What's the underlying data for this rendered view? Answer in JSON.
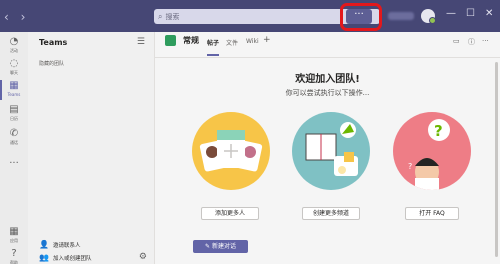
{
  "titlebar": {
    "nav_arrows": "‹ ›",
    "search_icon": "⌕",
    "search_placeholder": "搜索",
    "more_label": "···",
    "user_name": "",
    "window_controls": [
      "—",
      "☐",
      "✕"
    ]
  },
  "rail": {
    "items": [
      {
        "icon": "bell-icon",
        "glyph": "🔔",
        "label": "活动"
      },
      {
        "icon": "chat-icon",
        "glyph": "💬",
        "label": "聊天"
      },
      {
        "icon": "teams-icon",
        "glyph": "👥",
        "label": "Teams"
      },
      {
        "icon": "calendar-icon",
        "glyph": "📅",
        "label": "日历"
      },
      {
        "icon": "phone-icon",
        "glyph": "📞",
        "label": "通话"
      },
      {
        "icon": "more-icon",
        "glyph": "···",
        "label": ""
      }
    ],
    "bottom": [
      {
        "icon": "apps-icon",
        "glyph": "▦",
        "label": "应用"
      },
      {
        "icon": "help-icon",
        "glyph": "?",
        "label": "帮助"
      }
    ]
  },
  "panel": {
    "title": "Teams",
    "filter_icon": "☰",
    "hidden_teams": "隐藏的团队",
    "invite_label": "邀请联系人",
    "join_label": "加入或创建团队",
    "gear_icon": "⚙"
  },
  "channel": {
    "name": "常规",
    "tabs": [
      "帖子",
      "文件",
      "Wiki"
    ],
    "add_tab": "+",
    "header_icons": [
      "📹",
      "ⓘ",
      "···"
    ]
  },
  "welcome": {
    "title": "欢迎加入团队!",
    "subtitle": "你可以尝试执行以下操作..."
  },
  "cards": [
    {
      "button": "添加更多人",
      "color": "#f7c548"
    },
    {
      "button": "创建更多频道",
      "color": "#7fc1c4"
    },
    {
      "button": "打开 FAQ",
      "color": "#ee7d86"
    }
  ],
  "new_chat": "新建对话",
  "colors": {
    "titlebar": "#464775",
    "accent": "#6264a7",
    "highlight": "#e3181c"
  }
}
